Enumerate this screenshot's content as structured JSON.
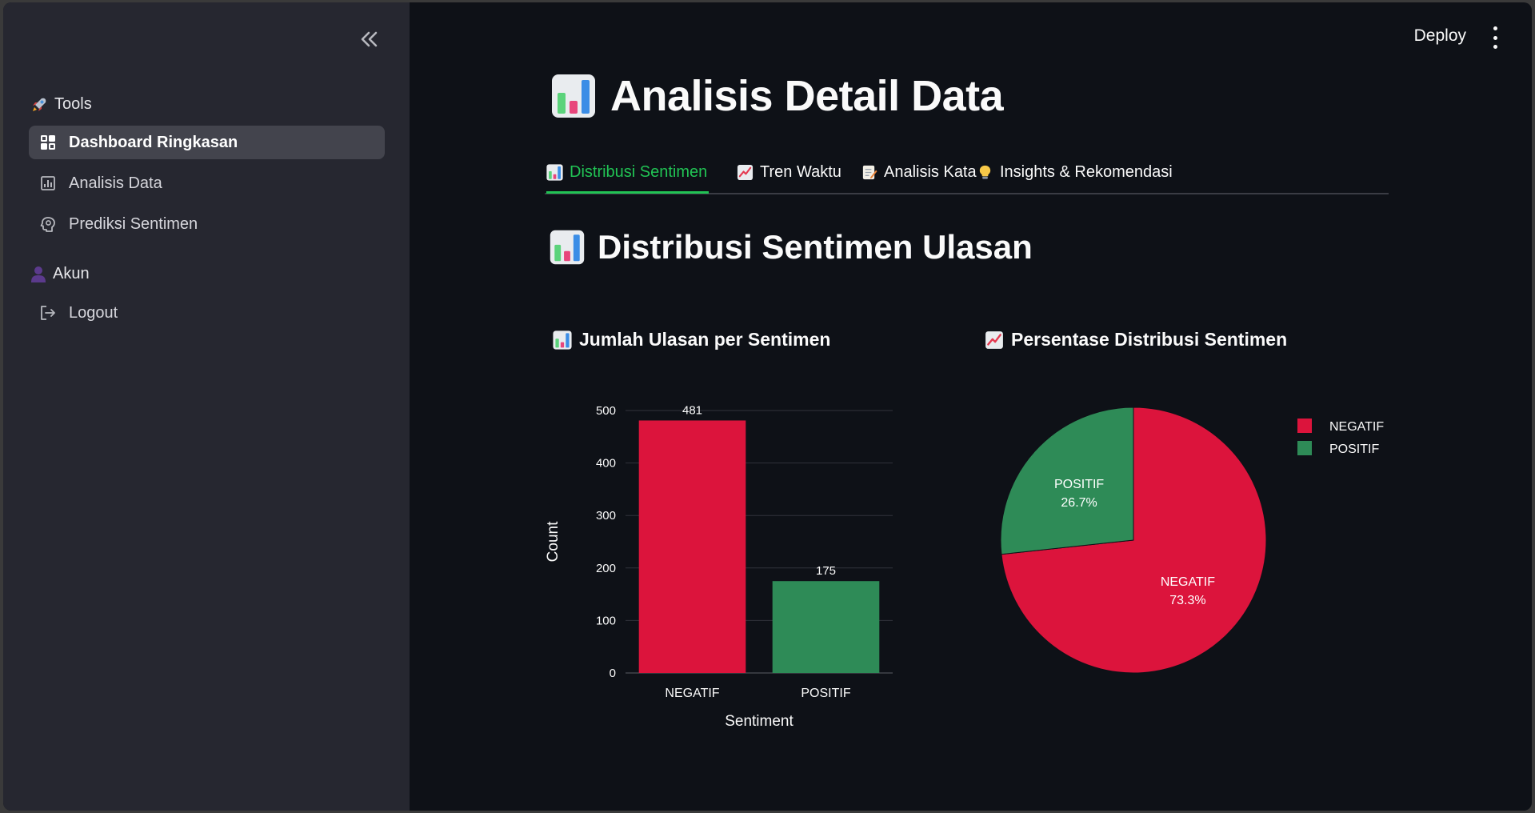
{
  "sidebar": {
    "collapse_icon": "double-chevron-left-icon",
    "tools_heading": "Tools",
    "tools_icon": "rocket-icon",
    "items": [
      {
        "label": "Dashboard Ringkasan",
        "icon": "dashboard-icon",
        "active": true
      },
      {
        "label": "Analisis Data",
        "icon": "chart-icon",
        "active": false
      },
      {
        "label": "Prediksi Sentimen",
        "icon": "psychology-icon",
        "active": false
      }
    ],
    "account_heading": "Akun",
    "account_icon": "user-icon",
    "logout_label": "Logout",
    "logout_icon": "logout-icon"
  },
  "header": {
    "deploy_label": "Deploy",
    "menu_icon": "kebab-menu-icon"
  },
  "page": {
    "title": "Analisis Detail Data",
    "title_icon": "bar-chart-icon",
    "tabs": [
      {
        "label": "Distribusi Sentimen",
        "icon": "bar-chart-icon",
        "active": true
      },
      {
        "label": "Tren Waktu",
        "icon": "chart-increasing-icon",
        "active": false
      },
      {
        "label": "Analisis Kata",
        "icon": "memo-icon",
        "active": false
      },
      {
        "label": "Insights & Rekomendasi",
        "icon": "light-bulb-icon",
        "active": false
      }
    ],
    "section_title": "Distribusi Sentimen Ulasan",
    "bar_chart_title": "Jumlah Ulasan per Sentimen",
    "pie_chart_title": "Persentase Distribusi Sentimen"
  },
  "colors": {
    "negatif": "#dc143c",
    "positif": "#2e8b57",
    "accent": "#21c354"
  },
  "chart_data": [
    {
      "type": "bar",
      "categories": [
        "NEGATIF",
        "POSITIF"
      ],
      "values": [
        481,
        175
      ],
      "data_labels": [
        "481",
        "175"
      ],
      "xlabel": "Sentiment",
      "ylabel": "Count",
      "ylim": [
        0,
        500
      ],
      "yticks": [
        0,
        100,
        200,
        300,
        400,
        500
      ],
      "grid": true
    },
    {
      "type": "pie",
      "labels": [
        "NEGATIF",
        "POSITIF"
      ],
      "values": [
        73.3,
        26.7
      ],
      "percent_labels": [
        "73.3%",
        "26.7%"
      ],
      "legend": [
        "NEGATIF",
        "POSITIF"
      ],
      "legend_position": "right"
    }
  ]
}
